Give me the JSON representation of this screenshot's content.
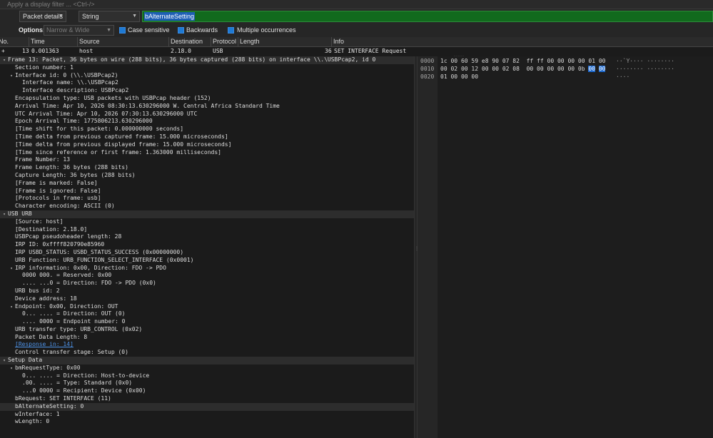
{
  "filter": {
    "placeholder": "Apply a display filter ... <Ctrl-/>"
  },
  "find": {
    "search_in": "Packet details",
    "search_type": "String",
    "search_value": "bAlternateSetting",
    "options_label": "Options:",
    "char_width": "Narrow & Wide",
    "case_sensitive": "Case sensitive",
    "backwards": "Backwards",
    "multiple": "Multiple occurrences"
  },
  "columns": [
    "No.",
    "Time",
    "Source",
    "Destination",
    "Protocol",
    "Length",
    "Info"
  ],
  "packet": {
    "no": "13",
    "time": "0.001363",
    "source": "host",
    "destination": "2.18.0",
    "protocol": "USB",
    "length": "36",
    "info": "SET INTERFACE Request",
    "marker": "+"
  },
  "details": [
    {
      "t": "Frame 13: Packet, 36 bytes on wire (288 bits), 36 bytes captured (288 bits) on interface \\\\.\\USBPcap2, id 0",
      "i": 0,
      "tw": "▾",
      "hdr": true
    },
    {
      "t": "Section number: 1",
      "i": 2
    },
    {
      "t": "Interface id: 0 (\\\\.\\USBPcap2)",
      "i": 2,
      "tw": "▾"
    },
    {
      "t": "Interface name: \\\\.\\USBPcap2",
      "i": 4
    },
    {
      "t": "Interface description: USBPcap2",
      "i": 4
    },
    {
      "t": "Encapsulation type: USB packets with USBPcap header (152)",
      "i": 2
    },
    {
      "t": "Arrival Time: Apr 10, 2026 08:30:13.630296000 W. Central Africa Standard Time",
      "i": 2
    },
    {
      "t": "UTC Arrival Time: Apr 10, 2026 07:30:13.630296000 UTC",
      "i": 2
    },
    {
      "t": "Epoch Arrival Time: 1775806213.630296000",
      "i": 2
    },
    {
      "t": "[Time shift for this packet: 0.000000000 seconds]",
      "i": 2
    },
    {
      "t": "[Time delta from previous captured frame: 15.000 microseconds]",
      "i": 2
    },
    {
      "t": "[Time delta from previous displayed frame: 15.000 microseconds]",
      "i": 2
    },
    {
      "t": "[Time since reference or first frame: 1.363000 milliseconds]",
      "i": 2
    },
    {
      "t": "Frame Number: 13",
      "i": 2
    },
    {
      "t": "Frame Length: 36 bytes (288 bits)",
      "i": 2
    },
    {
      "t": "Capture Length: 36 bytes (288 bits)",
      "i": 2
    },
    {
      "t": "[Frame is marked: False]",
      "i": 2
    },
    {
      "t": "[Frame is ignored: False]",
      "i": 2
    },
    {
      "t": "[Protocols in frame: usb]",
      "i": 2
    },
    {
      "t": "Character encoding: ASCII (0)",
      "i": 2
    },
    {
      "t": "USB URB",
      "i": 0,
      "tw": "▾",
      "hdr": true
    },
    {
      "t": "[Source: host]",
      "i": 2
    },
    {
      "t": "[Destination: 2.18.0]",
      "i": 2
    },
    {
      "t": "USBPcap pseudoheader length: 28",
      "i": 2
    },
    {
      "t": "IRP ID: 0xffff820790e85960",
      "i": 2
    },
    {
      "t": "IRP USBD_STATUS: USBD_STATUS_SUCCESS (0x00000000)",
      "i": 2
    },
    {
      "t": "URB Function: URB_FUNCTION_SELECT_INTERFACE (0x0001)",
      "i": 2
    },
    {
      "t": "IRP information: 0x00, Direction: FDO -> PDO",
      "i": 2,
      "tw": "▾"
    },
    {
      "t": "0000 000. = Reserved: 0x00",
      "i": 4
    },
    {
      "t": ".... ...0 = Direction: FDO -> PDO (0x0)",
      "i": 4
    },
    {
      "t": "URB bus id: 2",
      "i": 2
    },
    {
      "t": "Device address: 18",
      "i": 2
    },
    {
      "t": "Endpoint: 0x00, Direction: OUT",
      "i": 2,
      "tw": "▾"
    },
    {
      "t": "0... .... = Direction: OUT (0)",
      "i": 4
    },
    {
      "t": ".... 0000 = Endpoint number: 0",
      "i": 4
    },
    {
      "t": "URB transfer type: URB_CONTROL (0x02)",
      "i": 2
    },
    {
      "t": "Packet Data Length: 8",
      "i": 2
    },
    {
      "t": "[Response in: 14]",
      "i": 2,
      "link": true
    },
    {
      "t": "Control transfer stage: Setup (0)",
      "i": 2
    },
    {
      "t": "Setup Data",
      "i": 0,
      "tw": "▾",
      "hdr": true
    },
    {
      "t": "bmRequestType: 0x00",
      "i": 2,
      "tw": "▾"
    },
    {
      "t": "0... .... = Direction: Host-to-device",
      "i": 4
    },
    {
      "t": ".00. .... = Type: Standard (0x0)",
      "i": 4
    },
    {
      "t": "...0 0000 = Recipient: Device (0x00)",
      "i": 4
    },
    {
      "t": "bRequest: SET INTERFACE (11)",
      "i": 2
    },
    {
      "t": "bAlternateSetting: 0",
      "i": 2,
      "sel": true
    },
    {
      "t": "wInterface: 1",
      "i": 2
    },
    {
      "t": "wLength: 0",
      "i": 2
    }
  ],
  "hex": [
    {
      "off": "0000",
      "b": [
        "1c",
        "00",
        "60",
        "59",
        "e8",
        "90",
        "07",
        "82",
        "ff",
        "ff",
        "00",
        "00",
        "00",
        "00",
        "01",
        "00"
      ],
      "asc": "··`Y···· ········",
      "hl": []
    },
    {
      "off": "0010",
      "b": [
        "00",
        "02",
        "00",
        "12",
        "00",
        "00",
        "02",
        "08",
        "00",
        "00",
        "00",
        "00",
        "00",
        "0b",
        "00",
        "00"
      ],
      "asc": "········ ········",
      "hl": [
        14,
        15
      ]
    },
    {
      "off": "0020",
      "b": [
        "01",
        "00",
        "00",
        "00"
      ],
      "asc": "····",
      "hl": []
    }
  ],
  "colors": {
    "find_bg": "#116a1d",
    "highlight": "#1e6ad0",
    "link": "#4e93e8"
  }
}
